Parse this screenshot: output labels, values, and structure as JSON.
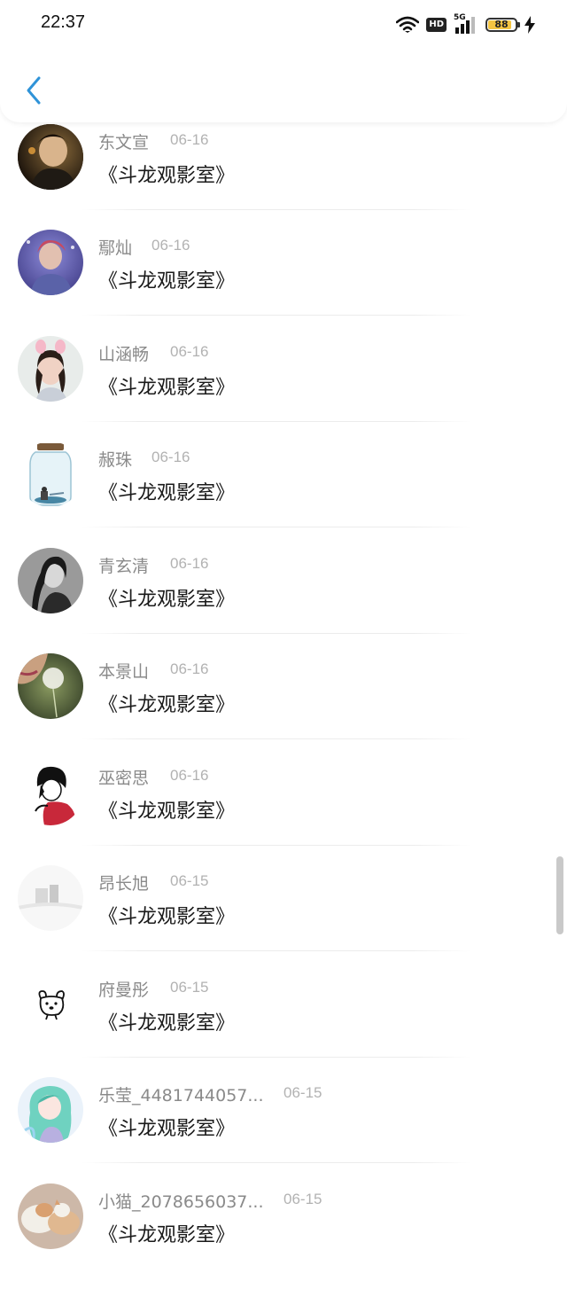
{
  "status_bar": {
    "time": "22:37",
    "network_badge": "HD",
    "signal_label": "5G",
    "battery_level": "88",
    "icons": [
      "wifi-icon",
      "hd-icon",
      "signal-icon",
      "battery-icon",
      "charging-icon"
    ]
  },
  "header": {
    "back_icon": "chevron-left-icon"
  },
  "accent_color": "#2f93d8",
  "list": {
    "items": [
      {
        "name": "东文宣",
        "date": "06-16",
        "title": "《斗龙观影室》",
        "avatar": "photo-dark-portrait"
      },
      {
        "name": "鄢灿",
        "date": "06-16",
        "title": "《斗龙观影室》",
        "avatar": "photo-purple-portrait"
      },
      {
        "name": "山涵畅",
        "date": "06-16",
        "title": "《斗龙观影室》",
        "avatar": "photo-girl-bunny-ears"
      },
      {
        "name": "赧珠",
        "date": "06-16",
        "title": "《斗龙观影室》",
        "avatar": "illustration-glass-jar"
      },
      {
        "name": "青玄清",
        "date": "06-16",
        "title": "《斗龙观影室》",
        "avatar": "photo-bw-woman"
      },
      {
        "name": "本景山",
        "date": "06-16",
        "title": "《斗龙观影室》",
        "avatar": "photo-dandelion"
      },
      {
        "name": "巫密思",
        "date": "06-16",
        "title": "《斗龙观影室》",
        "avatar": "illustration-red-hoodie"
      },
      {
        "name": "昂长旭",
        "date": "06-15",
        "title": "《斗龙观影室》",
        "avatar": "photo-faded-white"
      },
      {
        "name": "府曼彤",
        "date": "06-15",
        "title": "《斗龙观影室》",
        "avatar": "doodle-dog"
      },
      {
        "name": "乐莹_4481744057...",
        "date": "06-15",
        "title": "《斗龙观影室》",
        "avatar": "anime-green-hair"
      },
      {
        "name": "小猫_2078656037...",
        "date": "06-15",
        "title": "《斗龙观影室》",
        "avatar": "photo-cats"
      }
    ]
  }
}
